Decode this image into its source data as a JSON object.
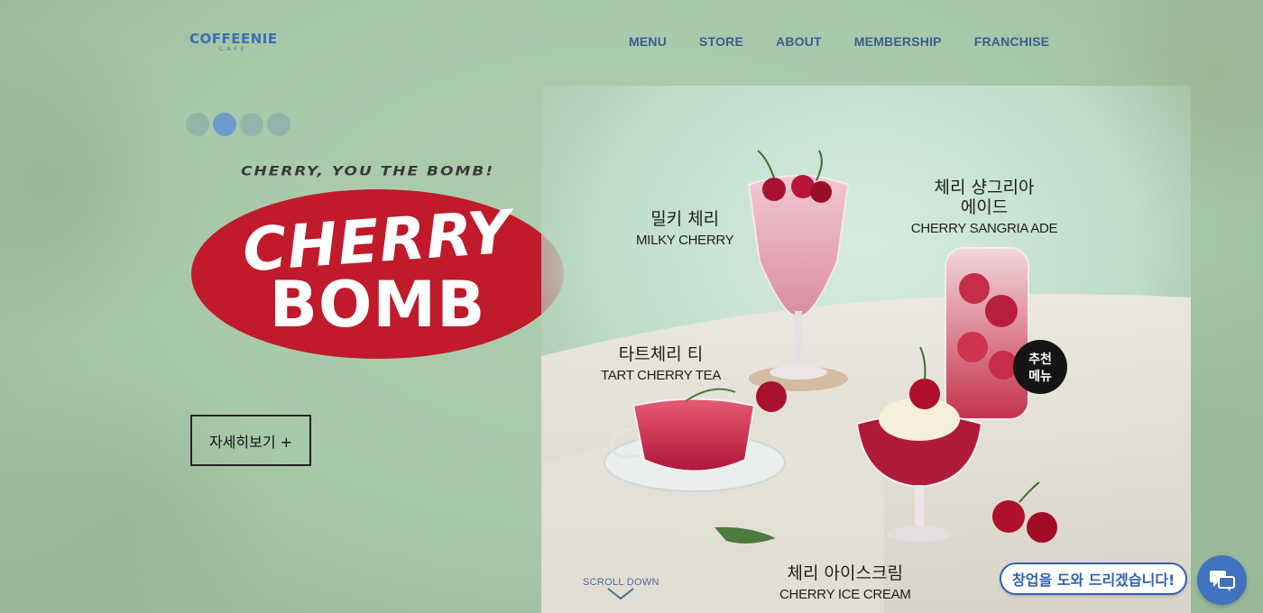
{
  "brand": {
    "name": "COFFEENIE",
    "sub": "CAFE"
  },
  "nav": [
    "MENU",
    "STORE",
    "ABOUT",
    "MEMBERSHIP",
    "FRANCHISE"
  ],
  "slider": {
    "count": 4,
    "active_index": 1
  },
  "hero": {
    "tagline": "CHERRY, YOU THE BOMB!",
    "logo_line1": "CHERRY",
    "logo_line2": "BOMB",
    "detail_button": "자세히보기 +"
  },
  "products": [
    {
      "ko": "밀키 체리",
      "en": "MILKY CHERRY"
    },
    {
      "ko": "체리 샹그리아\n에이드",
      "en": "CHERRY SANGRIA ADE"
    },
    {
      "ko": "타트체리 티",
      "en": "TART CHERRY TEA"
    },
    {
      "ko": "체리 아이스크림",
      "en": "CHERRY ICE CREAM"
    }
  ],
  "badge": {
    "line1": "추천",
    "line2": "메뉴"
  },
  "scroll_label": "SCROLL DOWN",
  "chat": {
    "bubble": "창업을 도와 드리겠습니다!",
    "icon": "chat-icon"
  },
  "colors": {
    "background": "#a8c8aa",
    "accent": "#c01a2b",
    "nav": "#3b5d8f",
    "chat": "#3f73bd"
  }
}
